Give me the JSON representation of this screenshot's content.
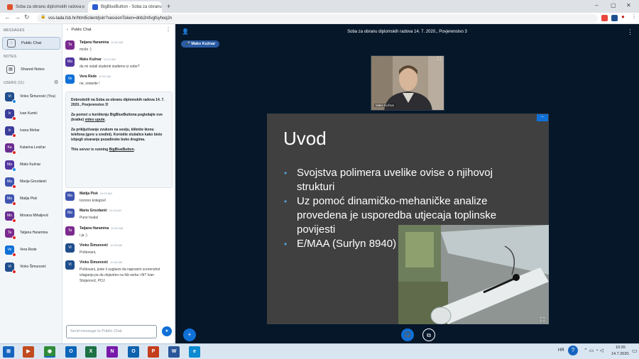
{
  "browser": {
    "tabs": [
      {
        "label": "Soba za obranu diplomskih radova",
        "fav_color": "#e0522b"
      },
      {
        "label": "BigBlueButton - Soba za obranu",
        "fav_color": "#2b5bd1"
      }
    ],
    "new_tab": "+",
    "url": "vss-lada.fsb.hr/html5client/join?sessionToken=dnb2mfvgfsyhoq2n",
    "window_controls": [
      "–",
      "▢",
      "✕"
    ]
  },
  "sidebar": {
    "messages_heading": "MESSAGES",
    "public_chat": "Public Chat",
    "notes_heading": "NOTES",
    "shared_notes": "Shared Notes",
    "users_heading": "USERS (11)",
    "users": [
      {
        "initials": "Vi",
        "name": "Vinko Šimunović (You)",
        "color": "#1f4e8c"
      },
      {
        "initials": "Iv",
        "name": "Ivan Kumić",
        "color": "#3a3d99"
      },
      {
        "initials": "Iv",
        "name": "Ivana Mohar",
        "color": "#3a3d99"
      },
      {
        "initials": "Ka",
        "name": "Katarina Lesičar",
        "color": "#6a2d91"
      },
      {
        "initials": "Ma",
        "name": "Maks Kužnar",
        "color": "#5236a0"
      },
      {
        "initials": "Ma",
        "name": "Marija Grozdanić",
        "color": "#3f54b0"
      },
      {
        "initials": "Ma",
        "name": "Matija Pisk",
        "color": "#3f54b0"
      },
      {
        "initials": "Mo",
        "name": "Morana Mihaljević",
        "color": "#6a2d91"
      },
      {
        "initials": "Ta",
        "name": "Tatjana Haramina",
        "color": "#7b2a8f"
      },
      {
        "initials": "Ve",
        "name": "Vera Rede",
        "color": "#0f70d7"
      },
      {
        "initials": "Vi",
        "name": "Vinko Šimunović",
        "color": "#1f4e8c"
      }
    ]
  },
  "chat": {
    "header": "Public Chat",
    "messages_top": [
      {
        "initials": "Ta",
        "color": "#7b2a8f",
        "name": "Tatjana Haramina",
        "time": "10:02 AM",
        "text": "može :)"
      },
      {
        "initials": "Ma",
        "color": "#5236a0",
        "name": "Maks Kužnar",
        "time": "10:02 AM",
        "text": "da mi ostali studenti izađemo iz sobe?"
      },
      {
        "initials": "Ve",
        "color": "#0f70d7",
        "name": "Vera Rede",
        "time": "10:02 AM",
        "text": "ne, ostanite !"
      }
    ],
    "welcome": {
      "line1_pre": "Dobrodošli na ",
      "line1_bold": "Soba za obranu diplomskih radova 14. 7. 2020., Povjerenstvo 3",
      "line1_post": "!",
      "line2_pre": "Za pomoć u korištenju BigBlueButtona pogledajte ove (kratke) ",
      "line2_link": "video upute",
      "line2_post": ".",
      "line3": "Za priključivanje zvukom na sesiju, kliknite ikonu telefona (gore u sredini). Koristite slušalice kako biste izbjegli stvaranje pozadinske buke drugima.",
      "line4_pre": "This server is running ",
      "line4_link": "BigBlueButton",
      "line4_post": "."
    },
    "messages_bottom": [
      {
        "initials": "Ma",
        "color": "#3f54b0",
        "name": "Matija Pisk",
        "time": "10:22 AM",
        "text": "Izvrsno kolegice!"
      },
      {
        "initials": "Ma",
        "color": "#3f54b0",
        "name": "Maria Grozdanić",
        "time": "10:25 AM",
        "text": "Puno hvala!"
      },
      {
        "initials": "Ta",
        "color": "#7b2a8f",
        "name": "Tatjana Haramina",
        "time": "10:25 AM",
        "text": "i ja :)"
      },
      {
        "initials": "Vi",
        "color": "#1f4e8c",
        "name": "Vinko Šimunović",
        "time": "10:25 AM",
        "text": "Poštovani,"
      },
      {
        "initials": "Vi",
        "color": "#1f4e8c",
        "name": "Vinko Šimunović",
        "time": "10:26 AM",
        "text": "Poštovani, jeste li suglasni da napravim screenshot izlaganja pa da objavimo na fsb webu i fb? Ivan Stojanović, POJ"
      }
    ],
    "input_placeholder": "Send message to Public Chat"
  },
  "meeting": {
    "title": "Soba za obranu diplomskih radova 14. 7. 2020., Povjerenstvo 3",
    "presenter": "Maks Kužnar",
    "webcam_label": "Maks Kužnar"
  },
  "slide": {
    "title": "Uvod",
    "bullets": [
      "Svojstva polimera uvelike ovise o njihovoj strukturi",
      "Uz pomoć dinamičko-mehaničke analize provedena je usporedba utjecaja toplinske povijesti",
      "E/MAA (Surlyn 8940)"
    ]
  },
  "taskbar": {
    "lang": "HR",
    "time": "10:26",
    "date": "14.7.2020.",
    "apps": [
      {
        "label": "⊞",
        "color": "#1565c0"
      },
      {
        "label": "▶",
        "color": "#c14a1e"
      },
      {
        "label": "◉",
        "color": "#2e8b3a"
      },
      {
        "label": "O",
        "color": "#0a64b8"
      },
      {
        "label": "X",
        "color": "#1e7145"
      },
      {
        "label": "N",
        "color": "#7719aa"
      },
      {
        "label": "O",
        "color": "#0f62ae"
      },
      {
        "label": "P",
        "color": "#c43e1c"
      },
      {
        "label": "W",
        "color": "#2b579a"
      },
      {
        "label": "e",
        "color": "#0c8bd1"
      }
    ]
  },
  "colors": {
    "accent": "#0f70d7",
    "presentation_bg": "#06172a",
    "slide_bg": "#404040",
    "bullet": "#4fa3d6"
  }
}
